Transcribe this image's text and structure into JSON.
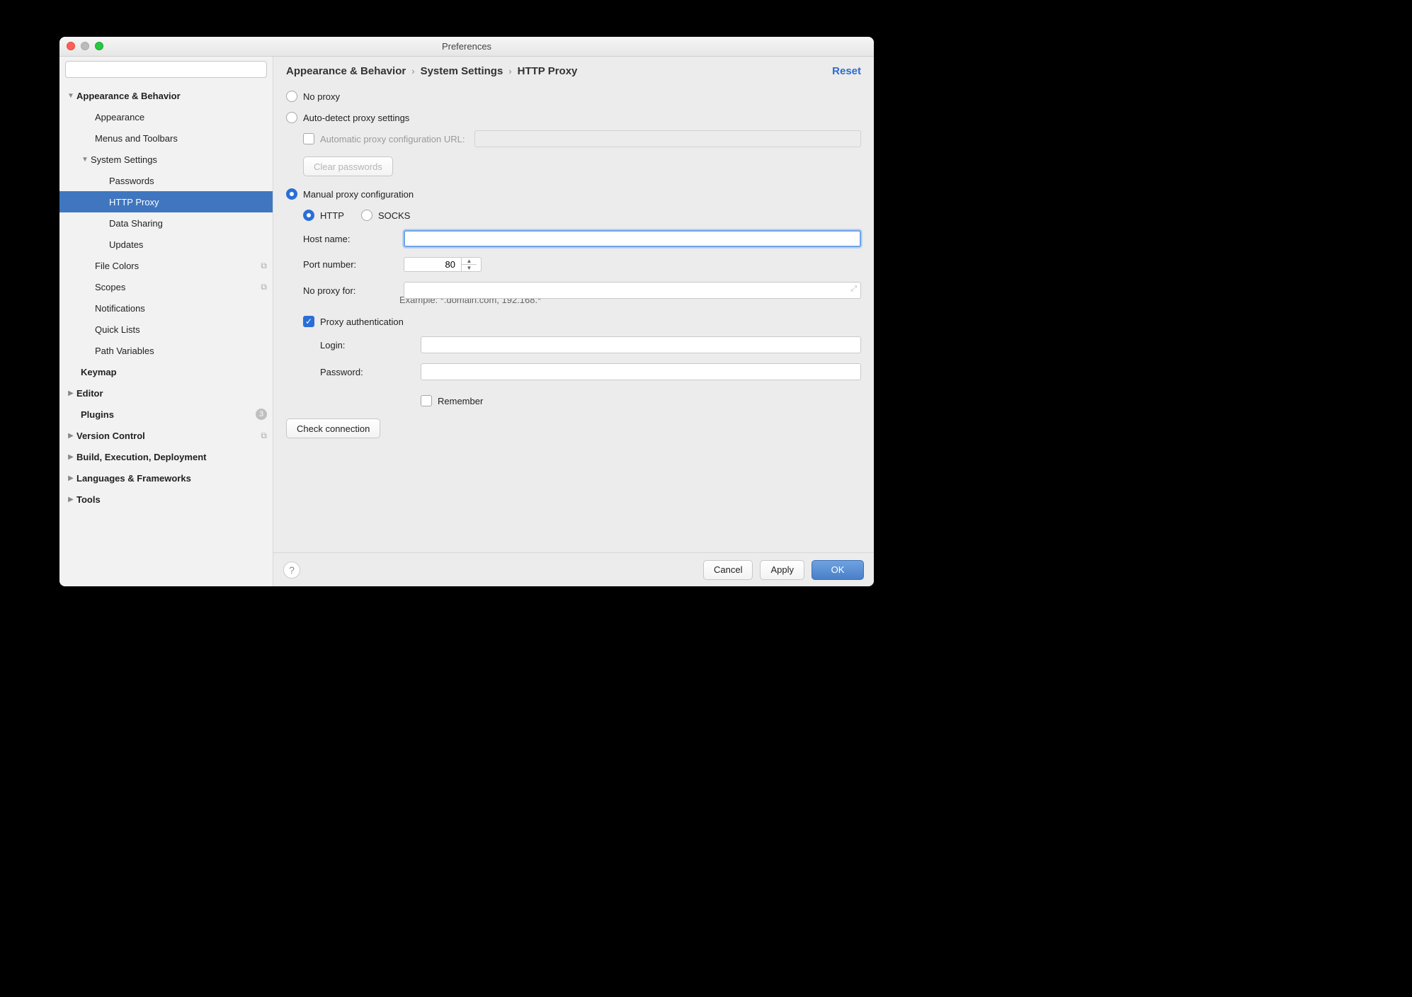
{
  "window": {
    "title": "Preferences"
  },
  "sidebar": {
    "search_placeholder": "",
    "items": {
      "appearance_behavior": "Appearance & Behavior",
      "appearance": "Appearance",
      "menus_toolbars": "Menus and Toolbars",
      "system_settings": "System Settings",
      "passwords": "Passwords",
      "http_proxy": "HTTP Proxy",
      "data_sharing": "Data Sharing",
      "updates": "Updates",
      "file_colors": "File Colors",
      "scopes": "Scopes",
      "notifications": "Notifications",
      "quick_lists": "Quick Lists",
      "path_variables": "Path Variables",
      "keymap": "Keymap",
      "editor": "Editor",
      "plugins": "Plugins",
      "plugins_badge": "3",
      "version_control": "Version Control",
      "build": "Build, Execution, Deployment",
      "languages": "Languages & Frameworks",
      "tools": "Tools"
    }
  },
  "breadcrumb": {
    "a": "Appearance & Behavior",
    "b": "System Settings",
    "c": "HTTP Proxy",
    "reset": "Reset"
  },
  "proxy": {
    "no_proxy": "No proxy",
    "auto_detect": "Auto-detect proxy settings",
    "auto_url_label": "Automatic proxy configuration URL:",
    "clear_passwords": "Clear passwords",
    "manual": "Manual proxy configuration",
    "http": "HTTP",
    "socks": "SOCKS",
    "host_label": "Host name:",
    "host_value": "",
    "port_label": "Port number:",
    "port_value": "80",
    "noproxy_label": "No proxy for:",
    "noproxy_value": "",
    "example": "Example: *.domain.com, 192.168.*",
    "auth": "Proxy authentication",
    "login_label": "Login:",
    "login_value": "",
    "password_label": "Password:",
    "password_value": "",
    "remember": "Remember",
    "check": "Check connection"
  },
  "footer": {
    "cancel": "Cancel",
    "apply": "Apply",
    "ok": "OK"
  }
}
